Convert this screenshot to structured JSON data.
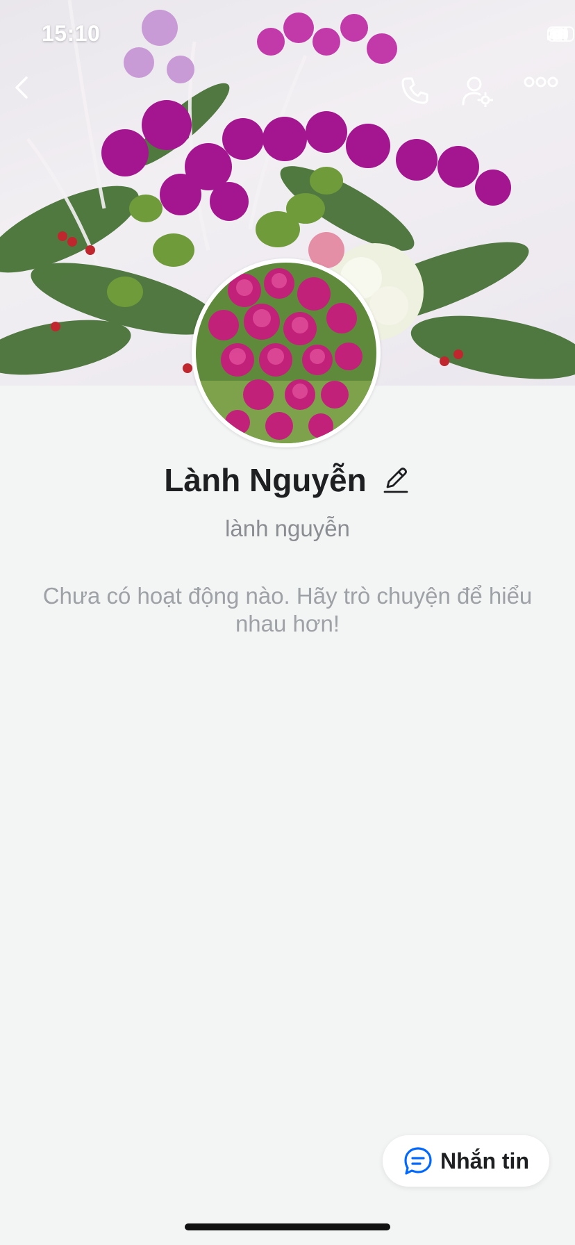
{
  "status_bar": {
    "time": "15:10"
  },
  "header": {
    "back_icon": "chevron-left-icon",
    "call_icon": "phone-icon",
    "user_settings_icon": "user-settings-icon",
    "more_icon": "more-dots-icon"
  },
  "profile": {
    "display_name": "Lành Nguyễn",
    "username": "lành nguyễn",
    "edit_icon": "pencil-icon",
    "empty_activity_message": "Chưa có hoạt động nào. Hãy trò chuyện để hiểu nhau hơn!"
  },
  "actions": {
    "message_button_label": "Nhắn tin",
    "message_icon": "chat-bubble-icon",
    "accent_color": "#0068ff"
  }
}
